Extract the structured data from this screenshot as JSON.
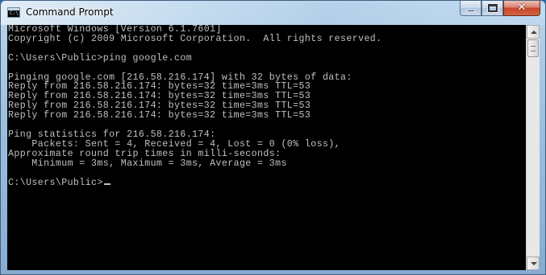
{
  "window": {
    "title": "Command Prompt",
    "controls": {
      "minimize": "minimize",
      "maximize": "maximize",
      "close": "✕"
    }
  },
  "console": {
    "lines": [
      "Microsoft Windows [Version 6.1.7601]",
      "Copyright (c) 2009 Microsoft Corporation.  All rights reserved.",
      "",
      "C:\\Users\\Public>ping google.com",
      "",
      "Pinging google.com [216.58.216.174] with 32 bytes of data:",
      "Reply from 216.58.216.174: bytes=32 time=3ms TTL=53",
      "Reply from 216.58.216.174: bytes=32 time=3ms TTL=53",
      "Reply from 216.58.216.174: bytes=32 time=3ms TTL=53",
      "Reply from 216.58.216.174: bytes=32 time=3ms TTL=53",
      "",
      "Ping statistics for 216.58.216.174:",
      "    Packets: Sent = 4, Received = 4, Lost = 0 (0% loss),",
      "Approximate round trip times in milli-seconds:",
      "    Minimum = 3ms, Maximum = 3ms, Average = 3ms",
      "",
      "C:\\Users\\Public>"
    ]
  },
  "colors": {
    "console_bg": "#000000",
    "console_fg": "#c0c0c0"
  }
}
